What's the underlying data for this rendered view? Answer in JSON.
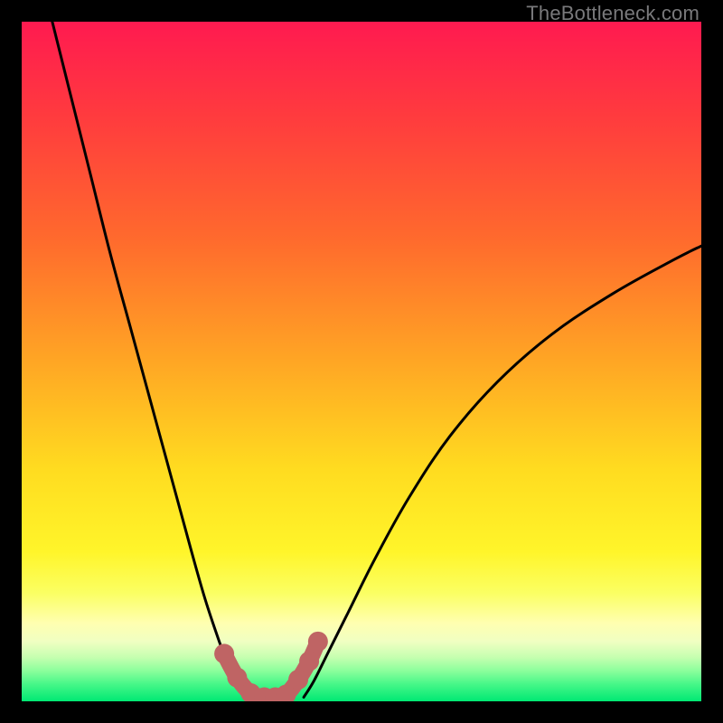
{
  "watermark": "TheBottleneck.com",
  "colors": {
    "frame": "#000000",
    "curve": "#000000",
    "marker_fill": "#bf6464",
    "marker_stroke": "#bf6464",
    "gradient_stops": [
      {
        "offset": 0.0,
        "color": "#ff1a50"
      },
      {
        "offset": 0.14,
        "color": "#ff3b3e"
      },
      {
        "offset": 0.32,
        "color": "#ff6a2d"
      },
      {
        "offset": 0.5,
        "color": "#ffa624"
      },
      {
        "offset": 0.66,
        "color": "#ffdc20"
      },
      {
        "offset": 0.78,
        "color": "#fff52a"
      },
      {
        "offset": 0.84,
        "color": "#fbff62"
      },
      {
        "offset": 0.885,
        "color": "#ffffb0"
      },
      {
        "offset": 0.912,
        "color": "#f0ffc2"
      },
      {
        "offset": 0.935,
        "color": "#c6ffb0"
      },
      {
        "offset": 0.955,
        "color": "#8cff9c"
      },
      {
        "offset": 0.975,
        "color": "#46f788"
      },
      {
        "offset": 1.0,
        "color": "#00e873"
      }
    ]
  },
  "chart_data": {
    "type": "line",
    "title": "",
    "xlabel": "",
    "ylabel": "",
    "xlim": [
      0,
      100
    ],
    "ylim": [
      0,
      100
    ],
    "grid": false,
    "legend": false,
    "series": [
      {
        "name": "left-curve",
        "x": [
          4.5,
          7,
          10,
          13,
          16,
          19,
          22,
          25,
          27,
          29,
          30.5,
          32,
          33.3
        ],
        "y": [
          100,
          90,
          78,
          66,
          55,
          44,
          33,
          22,
          15,
          9,
          5,
          2,
          0.6
        ]
      },
      {
        "name": "right-curve",
        "x": [
          41.5,
          43,
          45,
          48,
          52,
          57,
          63,
          70,
          78,
          87,
          96,
          100
        ],
        "y": [
          0.6,
          3,
          7,
          13,
          21,
          30,
          39,
          47,
          54,
          60,
          65,
          67
        ]
      },
      {
        "name": "trough-highlight-markers",
        "x": [
          29.8,
          31.7,
          33.7,
          35.7,
          37.3,
          38.9,
          40.7,
          42.3,
          43.6
        ],
        "y": [
          7.0,
          3.5,
          1.2,
          0.6,
          0.6,
          1.0,
          3.2,
          5.9,
          8.8
        ]
      }
    ],
    "annotations": [
      {
        "text": "TheBottleneck.com",
        "position": "top-right"
      }
    ]
  }
}
